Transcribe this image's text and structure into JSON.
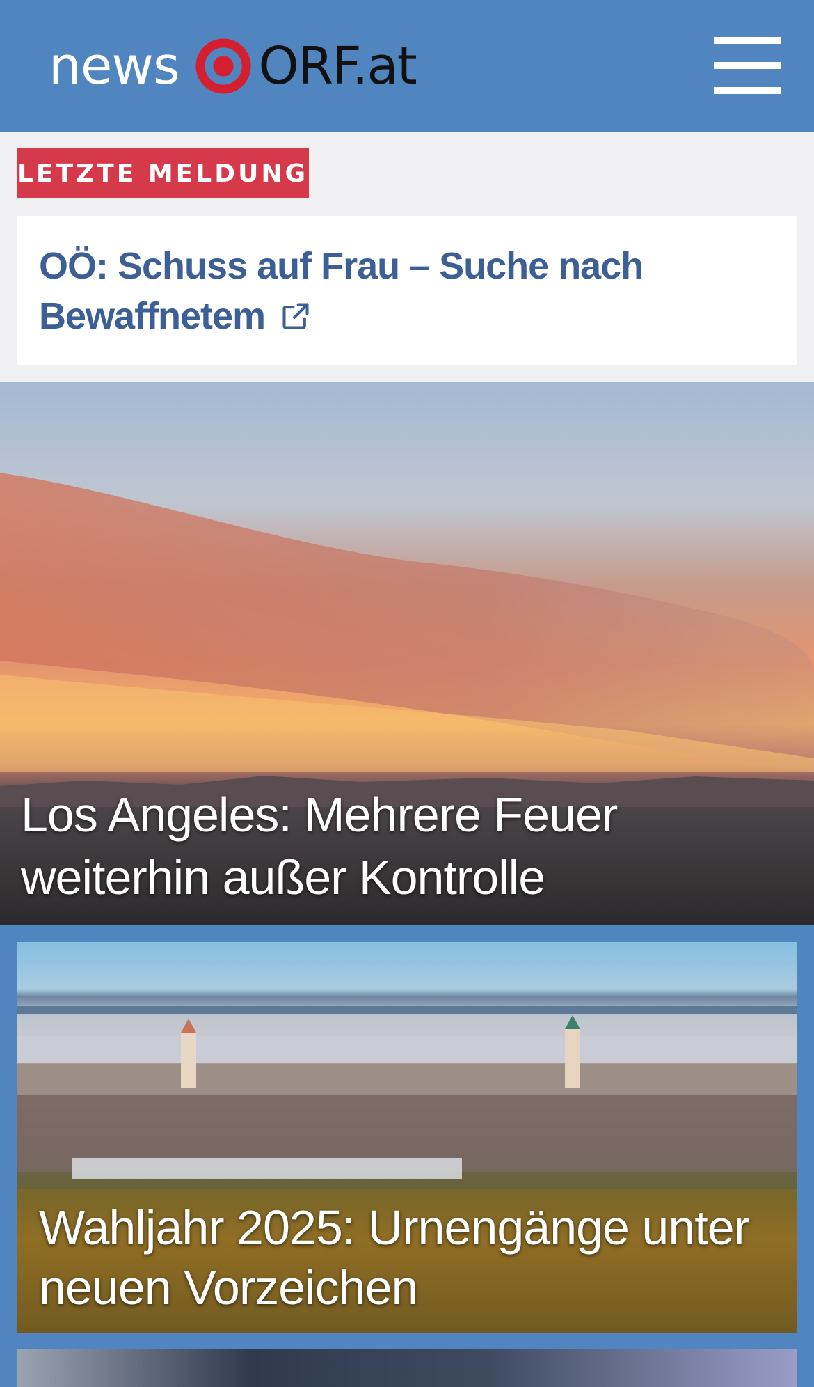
{
  "header": {
    "logo_news": "news",
    "logo_orf": "ORF.at",
    "menu_icon": "hamburger-menu-icon"
  },
  "latest": {
    "badge": "LETZTE MELDUNG",
    "headline": "OÖ: Schuss auf Frau – Suche nach Bewaffnetem",
    "link_icon": "external-link-icon"
  },
  "stories": [
    {
      "title": "Los Angeles: Mehrere Feuer weiterhin außer Kontrolle"
    },
    {
      "title": "Wahljahr 2025: Urnengänge unter neuen Vorzeichen"
    }
  ],
  "colors": {
    "header_bg": "#5185bf",
    "badge_bg": "#d5394a",
    "headline_text": "#3c5f96",
    "logo_red": "#d31f2f"
  }
}
